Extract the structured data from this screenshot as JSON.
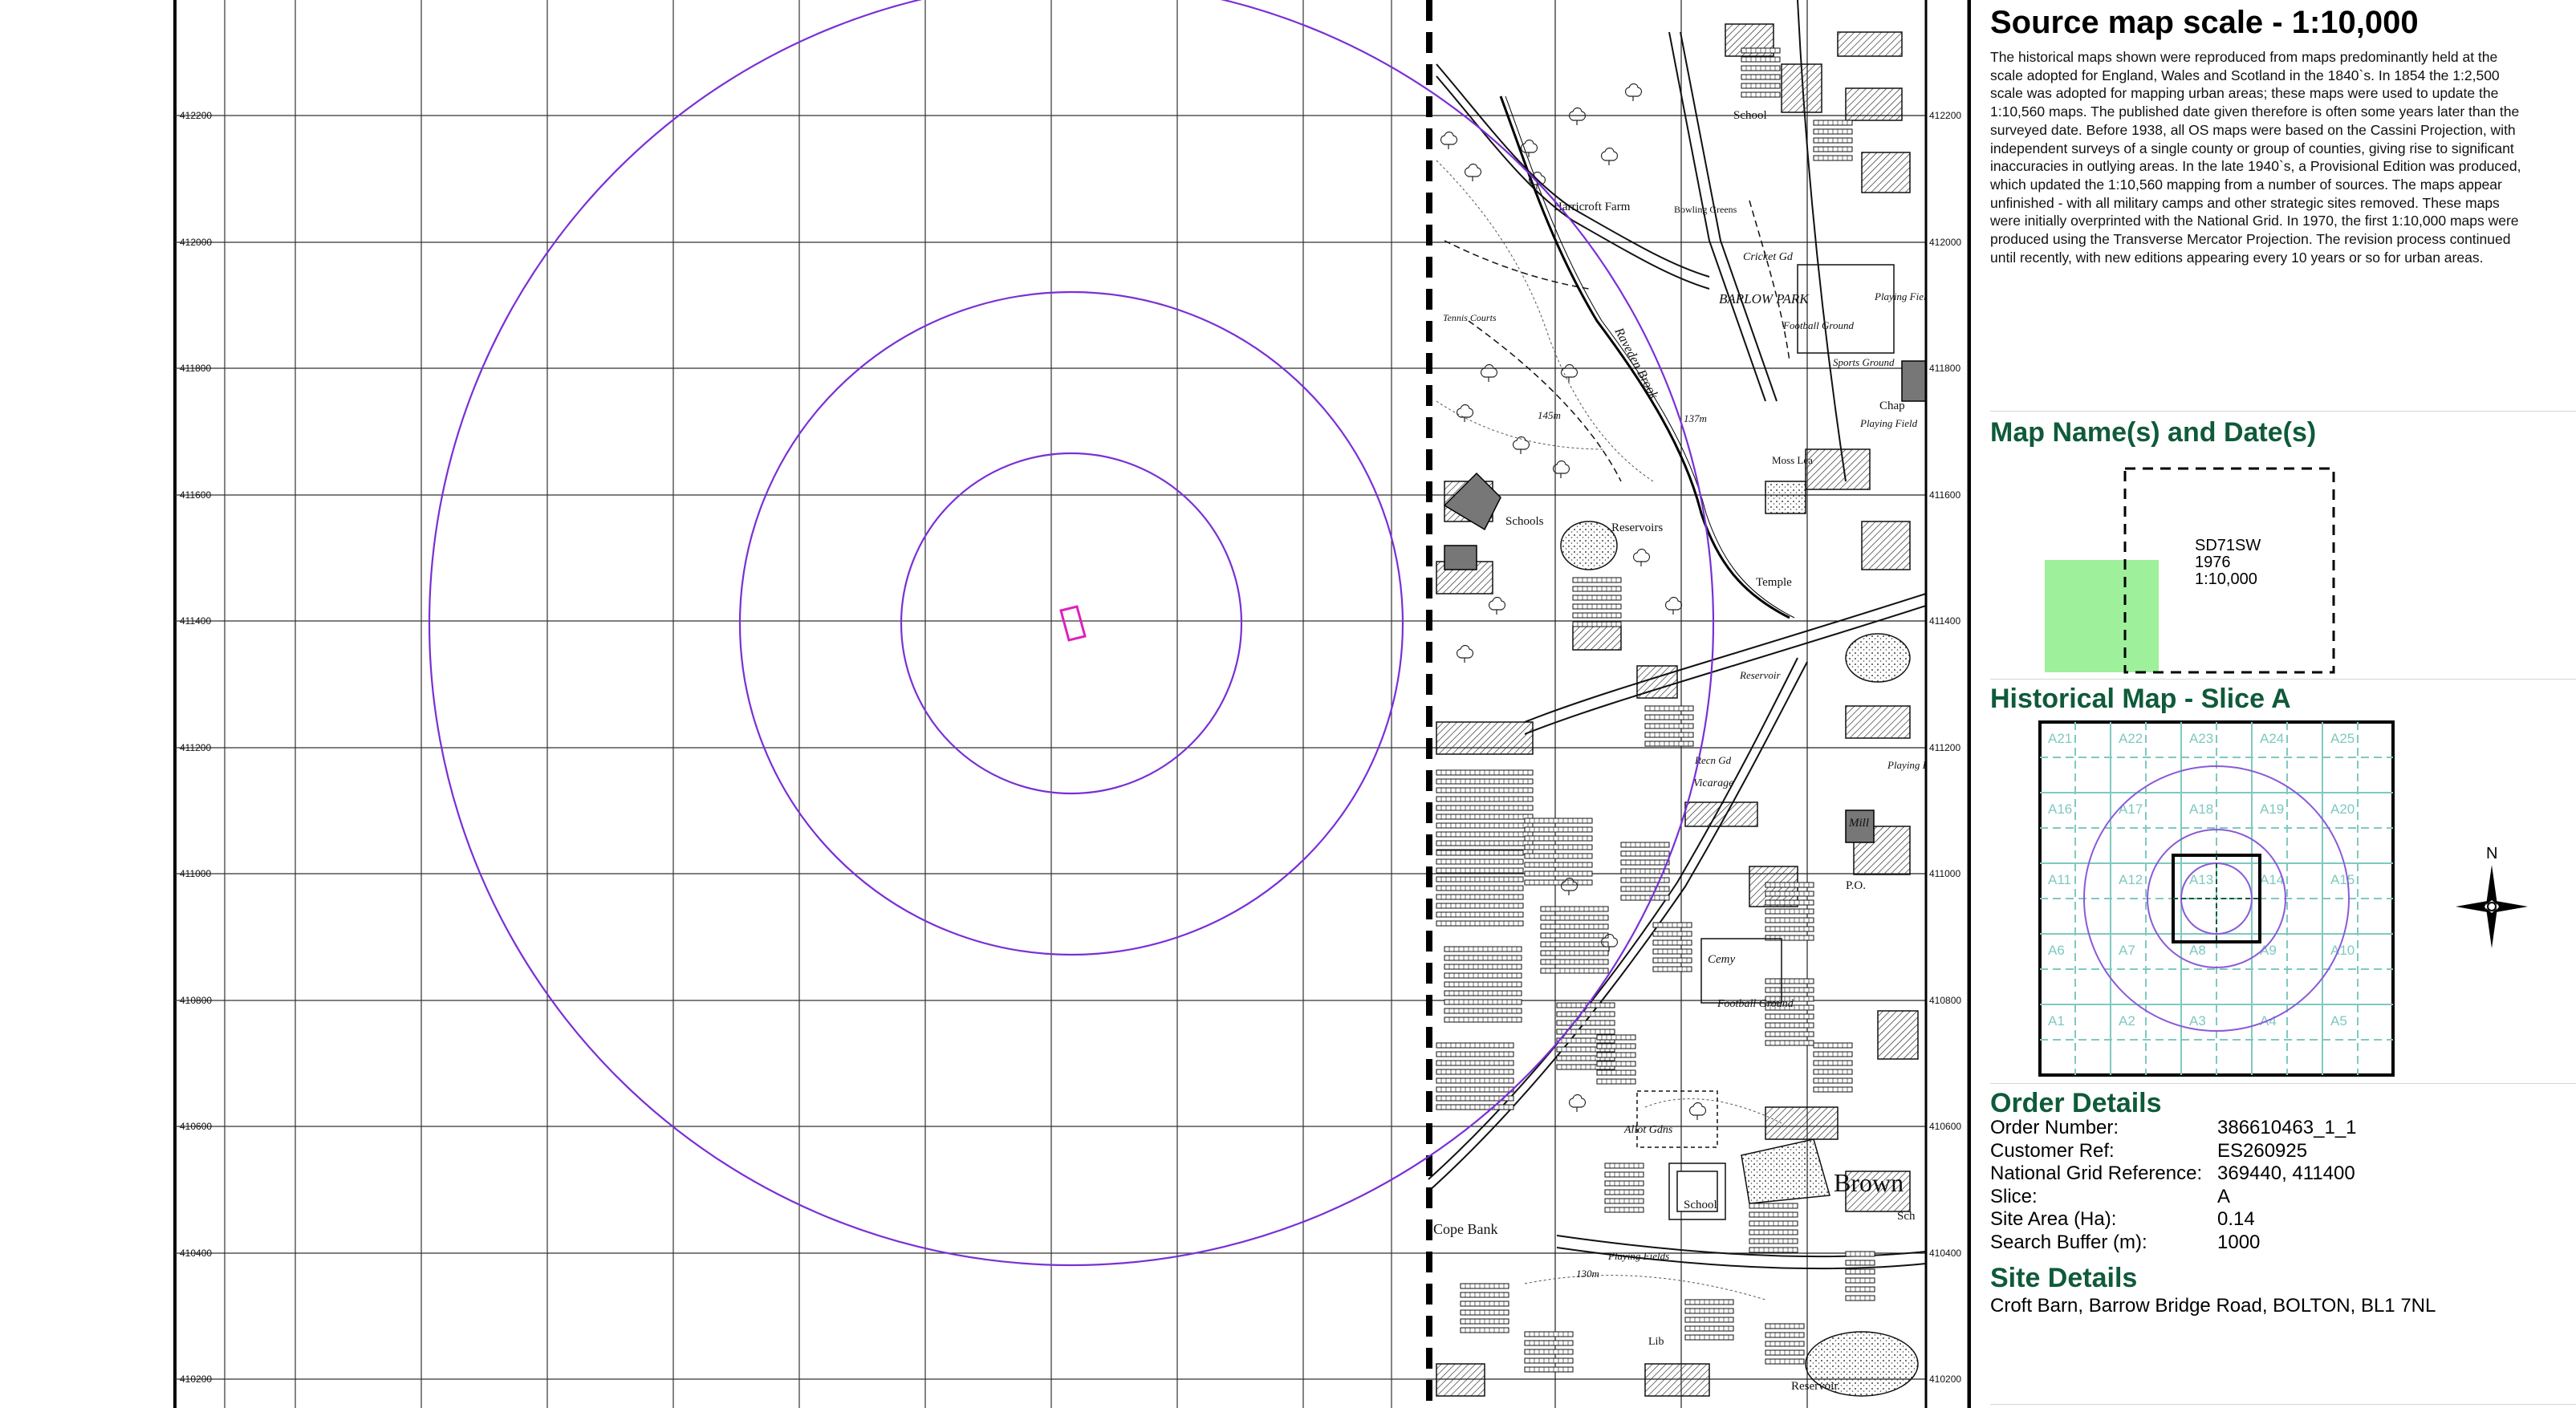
{
  "map": {
    "northing_labels_left": [
      "412200",
      "412000",
      "411800",
      "411600",
      "411400",
      "411200",
      "411000",
      "410800",
      "410600",
      "410400",
      "410200"
    ],
    "northing_labels_right": [
      "412200",
      "412000",
      "411800",
      "411600",
      "411400",
      "411200",
      "411000",
      "410800",
      "410600",
      "410400",
      "410200"
    ],
    "features": {
      "school_top": "School",
      "harricroft_farm": "Harricroft Farm",
      "bowling_greens": "Bowling Greens",
      "cricket_gd": "Cricket Gd",
      "barlow_park": "BARLOW PARK",
      "football_ground_1": "Football Ground",
      "playing_field_1": "Playing Field",
      "tennis_courts": "Tennis Courts",
      "sports_ground": "Sports Ground",
      "chap": "Chap",
      "playing_field_2": "Playing Field",
      "moss_lea": "Moss Lea",
      "schools": "Schools",
      "reservoirs": "Reservoirs",
      "temple": "Temple",
      "reservoir_mid": "Reservoir",
      "recn_gd": "Recn Gd",
      "vicarage": "Vicarage",
      "playing_field_3": "Playing Field",
      "mill": "Mill",
      "po": "P.O.",
      "cemy": "Cemy",
      "football_ground_2": "Football Ground",
      "allot_gdns": "Allot Gdns",
      "brown": "Brown",
      "school_bottom": "School",
      "sch": "Sch",
      "cope_bank": "Cope Bank",
      "playing_fields_bottom": "Playing Fields",
      "lib": "Lib",
      "reservoir_bottom": "Reservoir",
      "contour_145": "145m",
      "contour_137": "137m",
      "contour_130": "130m",
      "river": "Raveden Brook"
    }
  },
  "side": {
    "source_title": "Source map scale - 1:10,000",
    "source_text": "The historical maps shown were reproduced from maps predominantly held at the scale adopted for England, Wales and Scotland in the 1840`s. In 1854 the 1:2,500 scale was adopted for mapping urban areas; these maps were used to update the 1:10,560 maps. The published date given therefore is often some years later than the surveyed date. Before 1938, all OS maps were based on the Cassini Projection, with independent surveys of a single county or group of counties, giving rise to significant inaccuracies in outlying areas. In the late 1940`s, a Provisional Edition was produced, which updated the 1:10,560 mapping from a number of sources. The maps appear unfinished - with all military camps and other strategic sites removed. These maps were initially overprinted with the National Grid. In 1970, the first 1:10,000 maps were produced using the Transverse Mercator Projection. The revision process continued until recently, with new editions appearing every 10 years or so for urban areas.",
    "map_names_title": "Map Name(s) and Date(s)",
    "map_sheet": {
      "name": "SD71SW",
      "year": "1976",
      "scale": "1:10,000"
    },
    "slice_title": "Historical Map - Slice A",
    "slice_cells": [
      "A21",
      "A22",
      "A23",
      "A24",
      "A25",
      "A16",
      "A17",
      "A18",
      "A19",
      "A20",
      "A11",
      "A12",
      "A13",
      "A14",
      "A15",
      "A6",
      "A7",
      "A8",
      "A9",
      "A10",
      "A1",
      "A2",
      "A3",
      "A4",
      "A5"
    ],
    "north_label": "N",
    "order_title": "Order Details",
    "order": [
      {
        "label": "Order Number:",
        "value": "386610463_1_1"
      },
      {
        "label": "Customer Ref:",
        "value": "ES260925"
      },
      {
        "label": "National Grid Reference:",
        "value": "369440, 411400"
      },
      {
        "label": "Slice:",
        "value": "A"
      },
      {
        "label": "Site Area (Ha):",
        "value": "0.14"
      },
      {
        "label": "Search Buffer (m):",
        "value": "1000"
      }
    ],
    "site_title": "Site Details",
    "site_address": "Croft Barn, Barrow Bridge Road, BOLTON, BL1 7NL"
  },
  "colors": {
    "buffer_ring": "#7a2fd6",
    "site_outline": "#e020c0",
    "heading_green": "#0f5a3a",
    "sheet_fill": "#9ef09a",
    "slice_grid": "#7fc9c0"
  }
}
